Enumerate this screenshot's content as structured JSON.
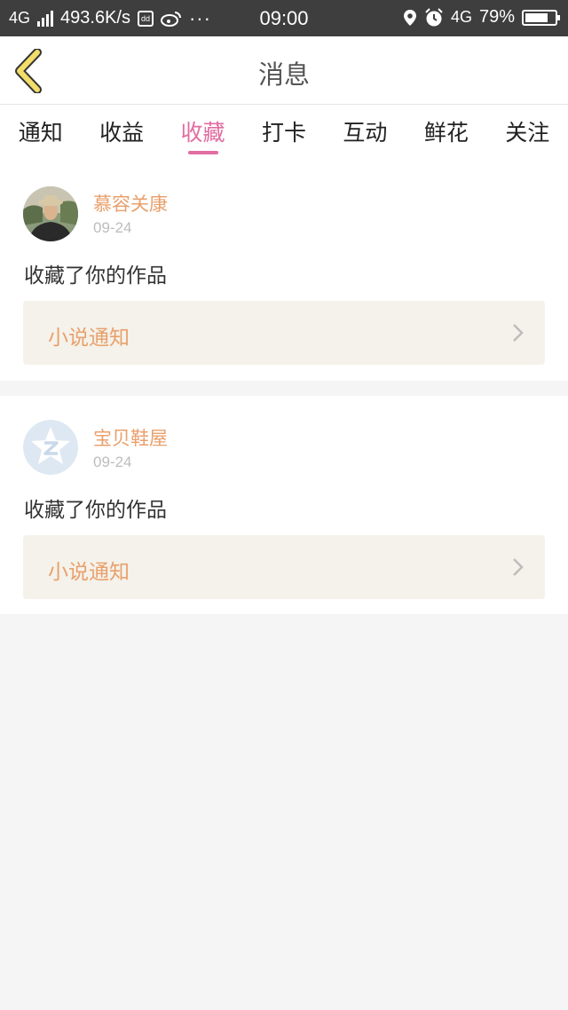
{
  "statusbar": {
    "network_left": "4G",
    "speed": "493.6K/s",
    "app_icon_text": "dd",
    "more_dots": "···",
    "time": "09:00",
    "network_right": "4G",
    "battery": "79%",
    "battery_level": 0.79,
    "icons": [
      "signal-icon",
      "app-icon",
      "weibo-icon",
      "location-icon",
      "alarm-icon",
      "battery-icon"
    ]
  },
  "navbar": {
    "title": "消息",
    "back_icon": "chevron-left-icon"
  },
  "tabs": [
    {
      "label": "通知",
      "active": false
    },
    {
      "label": "收益",
      "active": false
    },
    {
      "label": "收藏",
      "active": true
    },
    {
      "label": "打卡",
      "active": false
    },
    {
      "label": "互动",
      "active": false
    },
    {
      "label": "鲜花",
      "active": false
    },
    {
      "label": "关注",
      "active": false
    }
  ],
  "notifications": [
    {
      "username": "慕容关康",
      "date": "09-24",
      "message": "收藏了你的作品",
      "link_label": "小说通知",
      "avatar": "photo-avatar"
    },
    {
      "username": "宝贝鞋屋",
      "date": "09-24",
      "message": "收藏了你的作品",
      "link_label": "小说通知",
      "avatar": "default-avatar"
    }
  ],
  "colors": {
    "accent_pink": "#e26da2",
    "username_orange": "#e9a06c",
    "statusbar_bg": "#3e3e3e",
    "link_box_bg": "#f4f2ea",
    "back_icon_yellow": "#f2dd6a"
  }
}
